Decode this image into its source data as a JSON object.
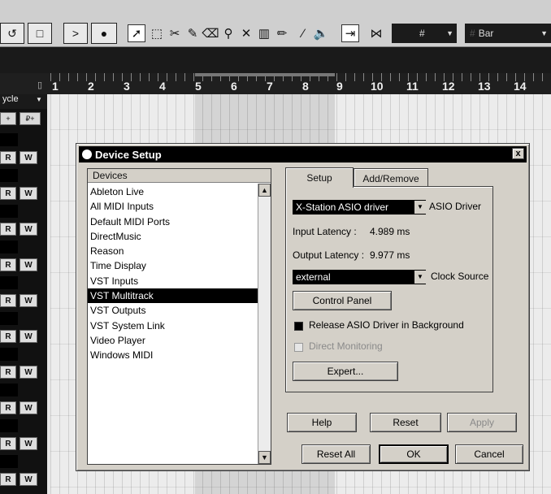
{
  "toolbar": {
    "transport": [
      "↺",
      "□",
      ">",
      "●"
    ],
    "tools": [
      "arrow-tool",
      "range-tool",
      "split-tool",
      "glue-tool",
      "eraser-tool",
      "zoom-tool",
      "mute-tool",
      "time-warp-tool",
      "draw-tool",
      "line-tool",
      "play-tool"
    ],
    "grid_symbol": "#",
    "grid_type": "Bar"
  },
  "ruler": {
    "numbers": [
      "1",
      "2",
      "3",
      "4",
      "5",
      "6",
      "7",
      "8",
      "9",
      "10",
      "11",
      "12",
      "13",
      "14"
    ]
  },
  "tracks": {
    "cycle_label": "ycle",
    "quant_labels": [
      "+",
      "₽+"
    ],
    "read_label": "R",
    "write_label": "W"
  },
  "dialog": {
    "title": "Device Setup",
    "close_label": "x",
    "devices_header": "Devices",
    "devices": [
      "Ableton Live",
      "All MIDI Inputs",
      "Default MIDI Ports",
      "DirectMusic",
      "Reason",
      "Time Display",
      "VST Inputs",
      "VST Multitrack",
      "VST Outputs",
      "VST System Link",
      "Video Player",
      "Windows MIDI"
    ],
    "selected_device": "VST Multitrack",
    "tabs": [
      "Setup",
      "Add/Remove"
    ],
    "active_tab": "Setup",
    "setup": {
      "asio_driver_value": "X-Station ASIO driver",
      "asio_driver_label": "ASIO Driver",
      "input_latency_label": "Input Latency :",
      "input_latency_value": "4.989 ms",
      "output_latency_label": "Output Latency :",
      "output_latency_value": "9.977 ms",
      "clock_source_value": "external",
      "clock_source_label": "Clock Source",
      "control_panel_label": "Control Panel",
      "release_asio_label": "Release ASIO Driver in Background",
      "release_asio_checked": true,
      "direct_monitoring_label": "Direct Monitoring",
      "direct_monitoring_enabled": false,
      "expert_label": "Expert..."
    },
    "help_label": "Help",
    "reset_label": "Reset",
    "apply_label": "Apply",
    "reset_all_label": "Reset All",
    "ok_label": "OK",
    "cancel_label": "Cancel"
  }
}
